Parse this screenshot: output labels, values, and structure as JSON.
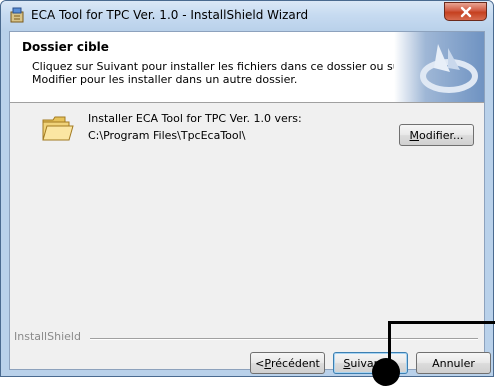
{
  "window": {
    "title": "ECA Tool for TPC Ver. 1.0 - InstallShield Wizard",
    "title_icon": "installer-icon",
    "close_icon": "close-icon"
  },
  "banner": {
    "title": "Dossier cible",
    "description": "Cliquez sur Suivant pour installer les fichiers dans ce dossier ou sur Modifier pour les installer dans un autre dossier.",
    "graphic_icon": "installshield-logo-icon"
  },
  "destination": {
    "folder_icon": "folder-icon",
    "label": "Installer ECA Tool for TPC Ver. 1.0 vers:",
    "path": "C:\\Program Files\\TpcEcaTool\\"
  },
  "buttons": {
    "modifier": {
      "accel": "M",
      "rest": "odifier..."
    },
    "back": {
      "pre": "< ",
      "accel": "P",
      "rest": "récédent"
    },
    "next": {
      "accel": "S",
      "rest": "uivant >"
    },
    "cancel": "Annuler"
  },
  "footer": {
    "brand": "InstallShield"
  },
  "colors": {
    "title_bar": "#c7dbf1",
    "close_button": "#c5401f",
    "dialog_bg": "#f0f0f0",
    "default_button_border": "#3c7fb1"
  }
}
